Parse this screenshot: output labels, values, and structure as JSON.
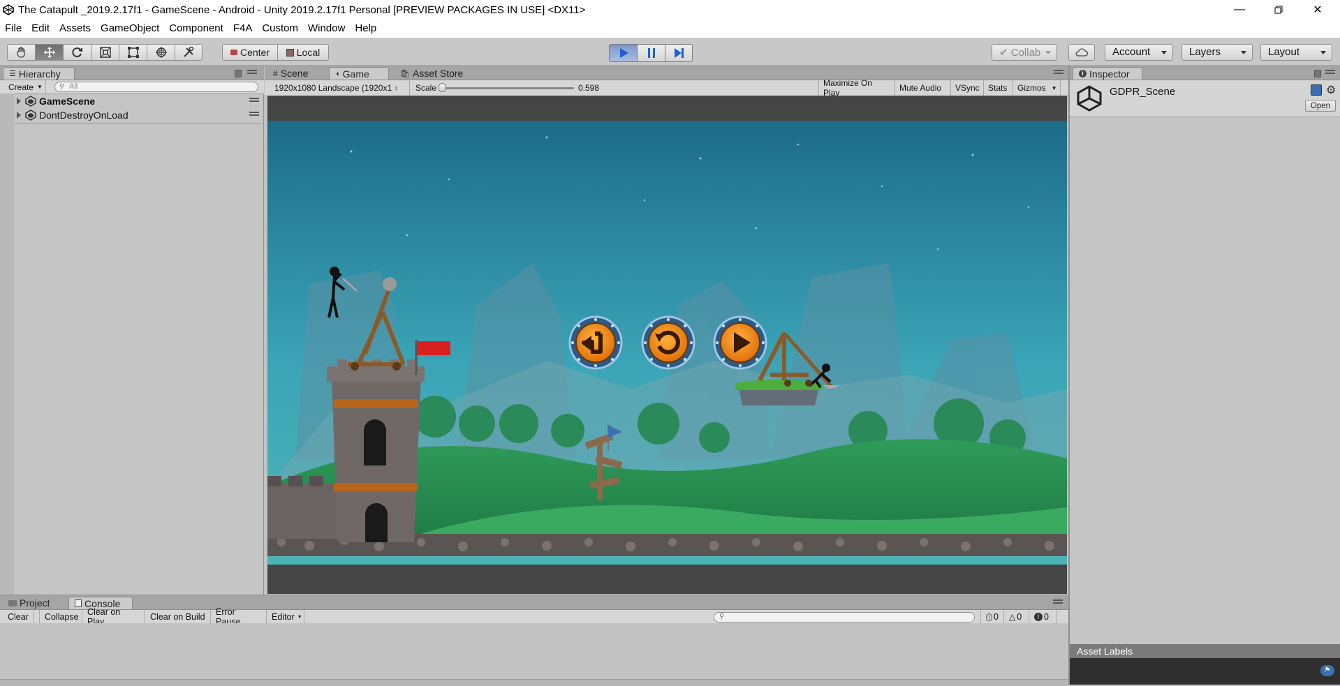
{
  "window": {
    "title": "The Catapult _2019.2.17f1 - GameScene - Android - Unity 2019.2.17f1 Personal [PREVIEW PACKAGES IN USE] <DX11>",
    "controls": [
      "minimize-icon",
      "restore-icon",
      "close-icon"
    ]
  },
  "menu": [
    "File",
    "Edit",
    "Assets",
    "GameObject",
    "Component",
    "F4A",
    "Custom",
    "Window",
    "Help"
  ],
  "toolbar": {
    "tools": [
      "hand-icon",
      "move-icon",
      "rotate-icon",
      "scale-icon",
      "rect-icon",
      "transform-icon",
      "custom-tool-icon"
    ],
    "pivot_center": "Center",
    "pivot_local": "Local",
    "collab": "Collab",
    "account": "Account",
    "layers": "Layers",
    "layout": "Layout"
  },
  "hierarchy": {
    "tab": "Hierarchy",
    "create": "Create",
    "search_placeholder": "All",
    "items": [
      {
        "label": "GameScene",
        "bold": true
      },
      {
        "label": "DontDestroyOnLoad",
        "bold": false
      }
    ]
  },
  "center_tabs": {
    "scene": "Scene",
    "game": "Game",
    "asset_store": "Asset Store"
  },
  "game_bar": {
    "resolution": "1920x1080 Landscape (1920x1",
    "scale_label": "Scale",
    "scale_value": "0.598",
    "scale_fraction": 0.0,
    "maximize": "Maximize On Play",
    "mute": "Mute Audio",
    "vsync": "VSync",
    "stats": "Stats",
    "gizmos": "Gizmos"
  },
  "game_buttons": [
    "back-button-icon",
    "restart-button-icon",
    "play-next-button-icon"
  ],
  "inspector": {
    "tab": "Inspector",
    "object_name": "GDPR_Scene",
    "open": "Open",
    "asset_labels": "Asset Labels"
  },
  "bottom_tabs": {
    "project": "Project",
    "console": "Console"
  },
  "console": {
    "clear": "Clear",
    "collapse": "Collapse",
    "clear_on_play": "Clear on Play",
    "clear_on_build": "Clear on Build",
    "error_pause": "Error Pause",
    "editor": "Editor",
    "info_count": "0",
    "warn_count": "0",
    "error_count": "0"
  },
  "colors": {
    "sky_top": "#1f6f8c",
    "sky_bottom": "#3fa7b8",
    "grass": "#2e9a55",
    "button_orange": "#f28a12",
    "button_ring": "#2d5b86"
  }
}
